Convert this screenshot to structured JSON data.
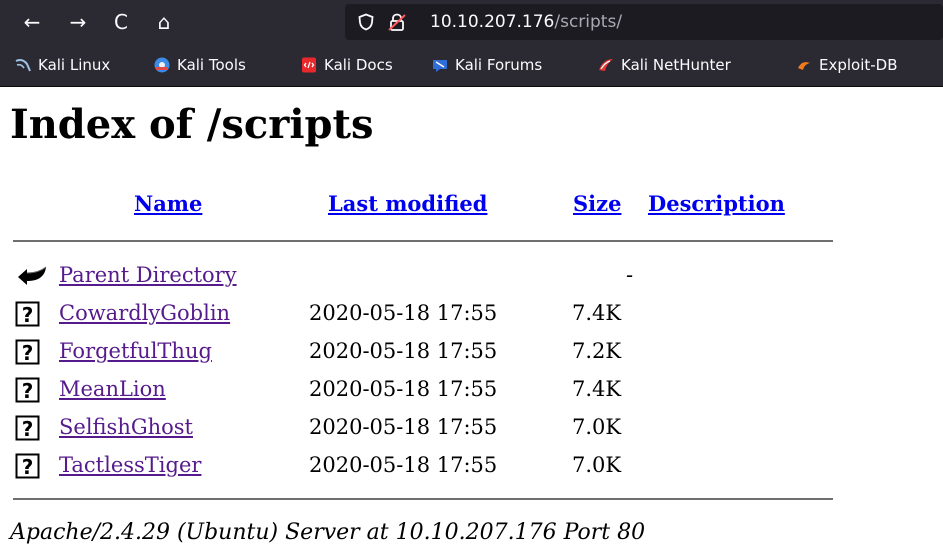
{
  "browser": {
    "back_glyph": "←",
    "forward_glyph": "→",
    "reload_glyph": "C",
    "home_glyph": "⌂",
    "url_host": "10.10.207.176",
    "url_path": "/scripts/"
  },
  "bookmarks": [
    {
      "label": "Kali Linux",
      "icon": "kali-dragon-icon",
      "color": "#9ec3e6"
    },
    {
      "label": "Kali Tools",
      "icon": "kali-tools-icon",
      "color": "#3d8be8"
    },
    {
      "label": "Kali Docs",
      "icon": "kali-docs-icon",
      "color": "#e8282b"
    },
    {
      "label": "Kali Forums",
      "icon": "kali-forums-icon",
      "color": "#2f6ed8"
    },
    {
      "label": "Kali NetHunter",
      "icon": "kali-nethunter-icon",
      "color": "#e23838"
    },
    {
      "label": "Exploit-DB",
      "icon": "exploit-db-icon",
      "color": "#f07b1d"
    }
  ],
  "page": {
    "title": "Index of /scripts",
    "columns": {
      "name": "Name",
      "last_modified": "Last modified",
      "size": "Size",
      "description": "Description"
    },
    "parent": {
      "name": "Parent Directory",
      "size": "-"
    },
    "files": [
      {
        "name": "CowardlyGoblin",
        "modified": "2020-05-18 17:55",
        "size": "7.4K"
      },
      {
        "name": "ForgetfulThug",
        "modified": "2020-05-18 17:55",
        "size": "7.2K"
      },
      {
        "name": "MeanLion",
        "modified": "2020-05-18 17:55",
        "size": "7.4K"
      },
      {
        "name": "SelfishGhost",
        "modified": "2020-05-18 17:55",
        "size": "7.0K"
      },
      {
        "name": "TactlessTiger",
        "modified": "2020-05-18 17:55",
        "size": "7.0K"
      }
    ],
    "footer": "Apache/2.4.29 (Ubuntu) Server at 10.10.207.176 Port 80"
  },
  "colors": {
    "link": "#0000ee",
    "visited_link": "#551a8b",
    "chrome_bg": "#2b2a33"
  }
}
